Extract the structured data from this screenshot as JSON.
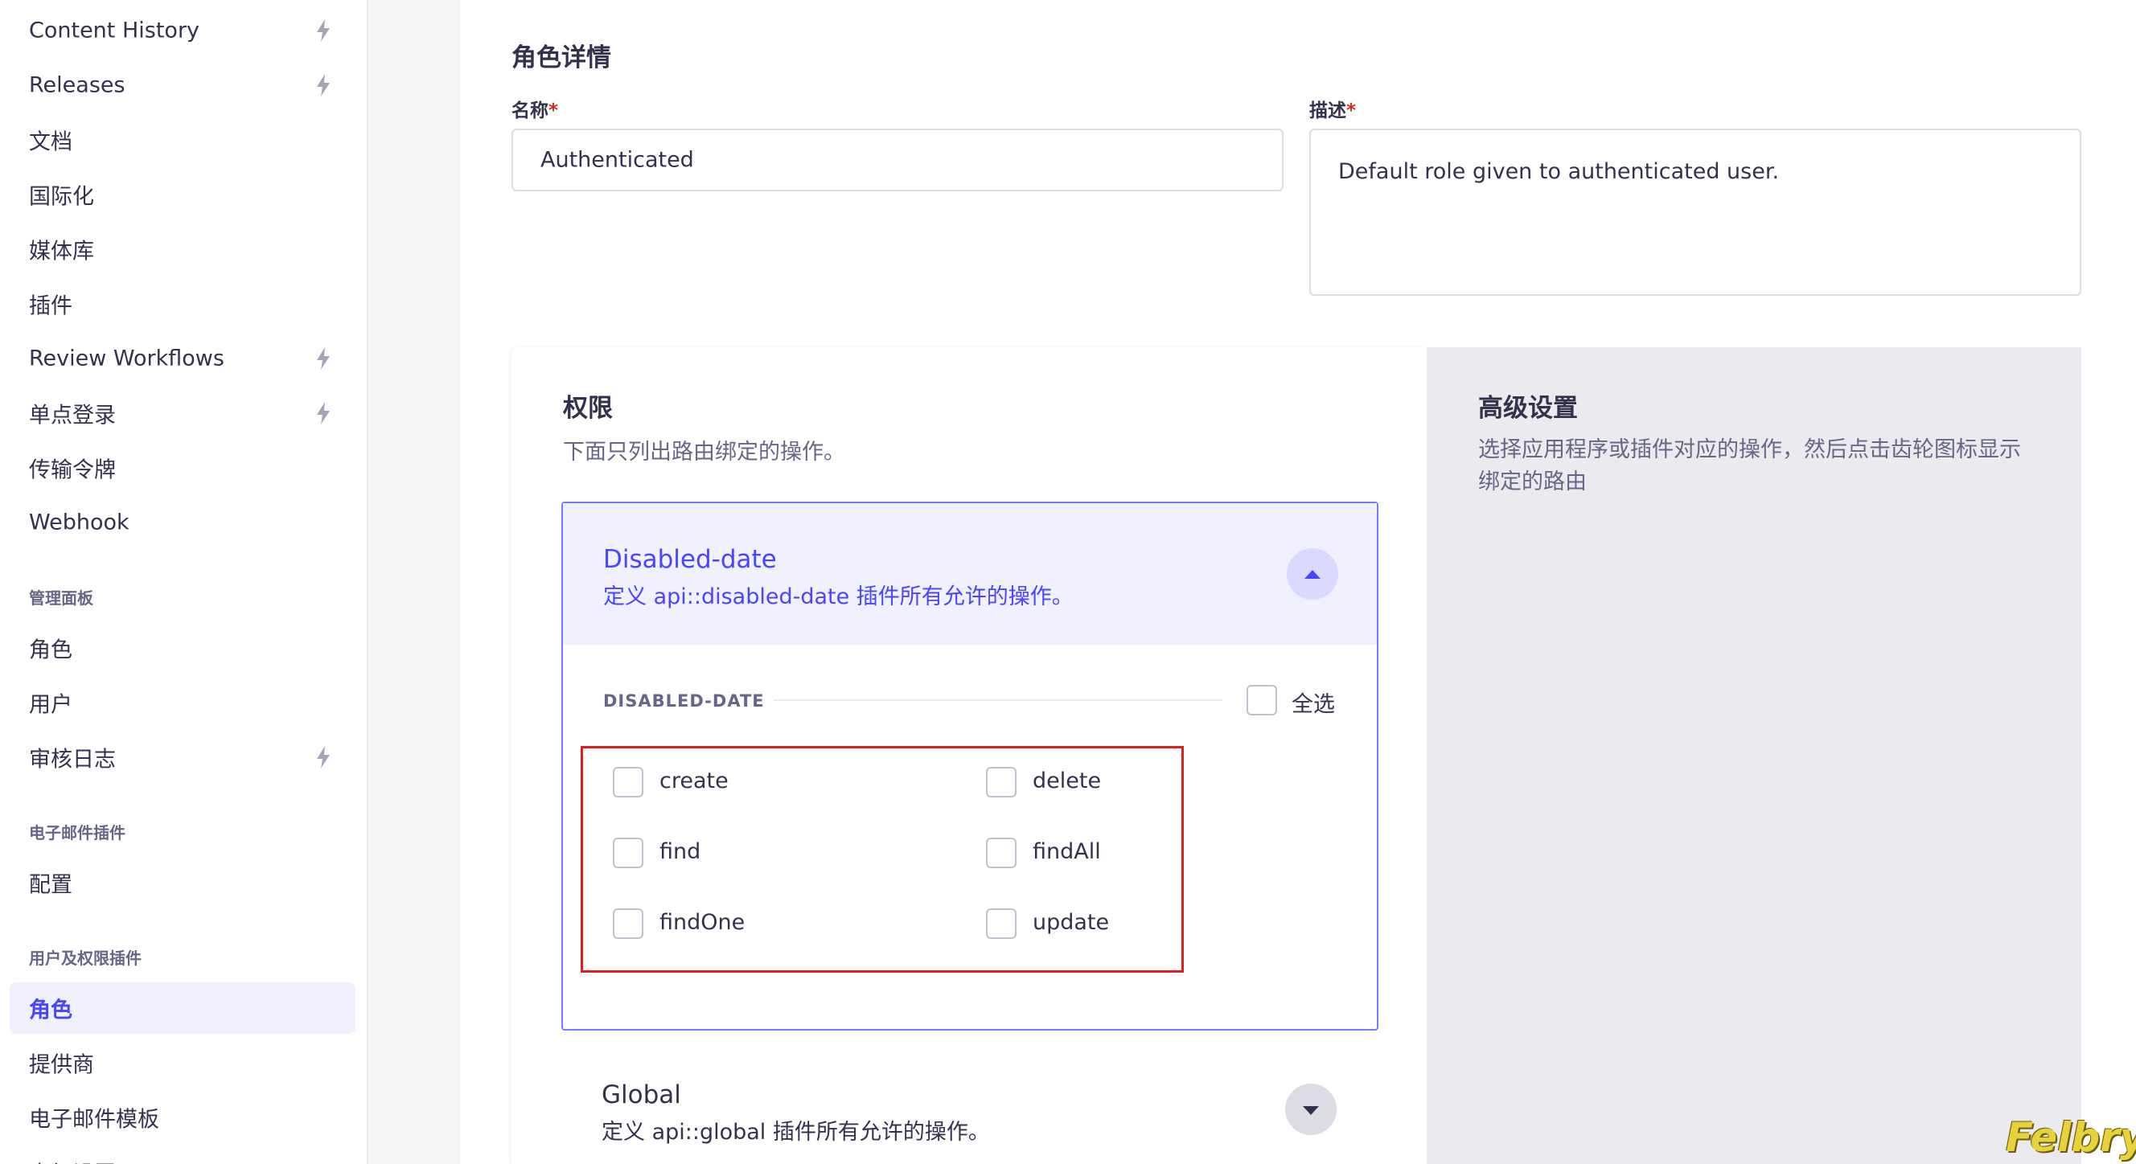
{
  "sidebar": {
    "items_top": [
      {
        "label": "Content History",
        "premium": true
      },
      {
        "label": "Releases",
        "premium": true
      },
      {
        "label": "文档",
        "premium": false
      },
      {
        "label": "国际化",
        "premium": false
      },
      {
        "label": "媒体库",
        "premium": false
      },
      {
        "label": "插件",
        "premium": false
      },
      {
        "label": "Review Workflows",
        "premium": true
      },
      {
        "label": "单点登录",
        "premium": true
      },
      {
        "label": "传输令牌",
        "premium": false
      },
      {
        "label": "Webhook",
        "premium": false
      }
    ],
    "section_admin": "管理面板",
    "items_admin": [
      {
        "label": "角色",
        "premium": false
      },
      {
        "label": "用户",
        "premium": false
      },
      {
        "label": "审核日志",
        "premium": true
      }
    ],
    "section_email": "电子邮件插件",
    "items_email": [
      {
        "label": "配置",
        "premium": false
      }
    ],
    "section_users": "用户及权限插件",
    "items_users": [
      {
        "label": "角色",
        "active": true
      },
      {
        "label": "提供商",
        "active": false
      },
      {
        "label": "电子邮件模板",
        "active": false
      },
      {
        "label": "高级设置",
        "active": false
      }
    ],
    "premium_icon": "lightning-icon"
  },
  "role_details": {
    "heading": "角色详情",
    "name_label": "名称",
    "name_value": "Authenticated",
    "desc_label": "描述",
    "desc_value": "Default role given to authenticated user.",
    "required_mark": "*"
  },
  "permissions": {
    "title": "权限",
    "subtitle": "下面只列出路由绑定的操作。",
    "accordion": {
      "title": "Disabled-date",
      "subtitle": "定义 api::disabled-date 插件所有允许的操作。",
      "expanded": true,
      "group_label": "DISABLED-DATE",
      "select_all_label": "全选",
      "actions": [
        {
          "label": "create",
          "checked": false
        },
        {
          "label": "delete",
          "checked": false
        },
        {
          "label": "find",
          "checked": false
        },
        {
          "label": "findAll",
          "checked": false
        },
        {
          "label": "findOne",
          "checked": false
        },
        {
          "label": "update",
          "checked": false
        }
      ]
    },
    "global": {
      "title": "Global",
      "subtitle": "定义 api::global 插件所有允许的操作。",
      "expanded": false
    }
  },
  "advanced": {
    "title": "高级设置",
    "description": "选择应用程序或插件对应的操作，然后点击齿轮图标显示绑定的路由"
  },
  "watermark": "Felbry",
  "colors": {
    "primary": "#4945ff",
    "highlight": "#e0201f",
    "required": "#d02b20"
  }
}
